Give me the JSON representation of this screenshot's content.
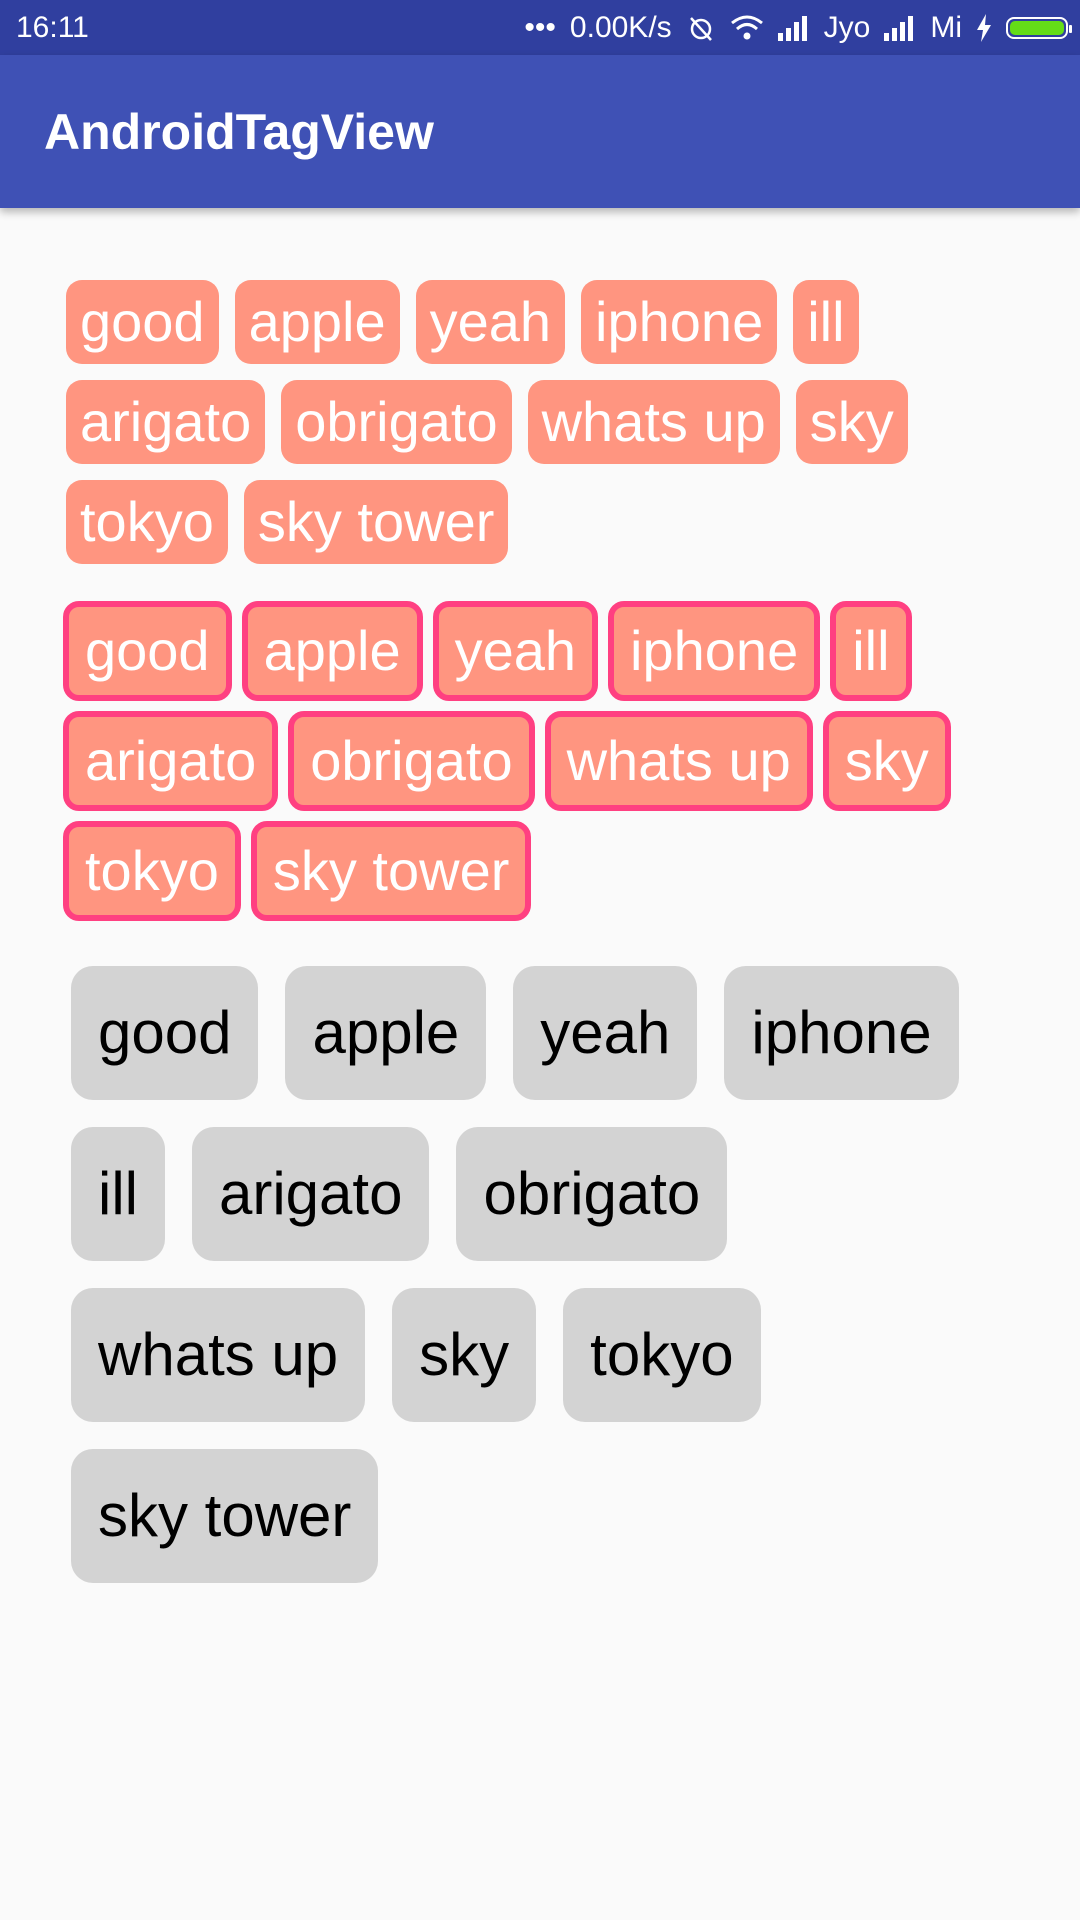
{
  "status_bar": {
    "time": "16:11",
    "more": "•••",
    "speed": "0.00K/s",
    "carrier1": "Jyo",
    "carrier2": "Mi",
    "battery_color": "#64dd17"
  },
  "app_bar": {
    "title": "AndroidTagView"
  },
  "colors": {
    "primary": "#3f51b5",
    "primary_dark": "#303f9f",
    "tag_fill": "#ff9580",
    "tag_border": "#ff4081",
    "tag_gray": "#d3d3d3"
  },
  "group1": {
    "tags": [
      "good",
      "apple",
      "yeah",
      "iphone",
      "ill",
      "arigato",
      "obrigato",
      "whats up",
      "sky",
      "tokyo",
      "sky tower"
    ]
  },
  "group2": {
    "tags": [
      "good",
      "apple",
      "yeah",
      "iphone",
      "ill",
      "arigato",
      "obrigato",
      "whats up",
      "sky",
      "tokyo",
      "sky tower"
    ]
  },
  "group3": {
    "tags": [
      "good",
      "apple",
      "yeah",
      "iphone",
      "ill",
      "arigato",
      "obrigato",
      "whats up",
      "sky",
      "tokyo",
      "sky tower"
    ]
  }
}
